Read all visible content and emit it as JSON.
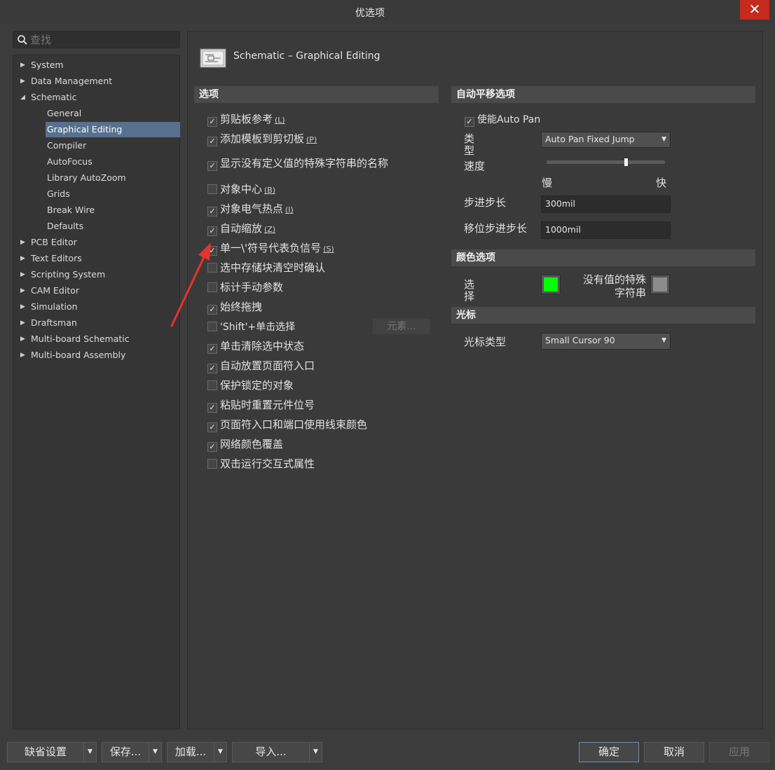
{
  "window": {
    "title": "优选项",
    "close_glyph": "✕"
  },
  "search": {
    "placeholder": "查找",
    "icon": "search-icon"
  },
  "tree": [
    {
      "label": "System",
      "level": 0,
      "expanded": false
    },
    {
      "label": "Data Management",
      "level": 0,
      "expanded": false
    },
    {
      "label": "Schematic",
      "level": 0,
      "expanded": true
    },
    {
      "label": "General",
      "level": 1
    },
    {
      "label": "Graphical Editing",
      "level": 1,
      "selected": true
    },
    {
      "label": "Compiler",
      "level": 1
    },
    {
      "label": "AutoFocus",
      "level": 1
    },
    {
      "label": "Library AutoZoom",
      "level": 1
    },
    {
      "label": "Grids",
      "level": 1
    },
    {
      "label": "Break Wire",
      "level": 1
    },
    {
      "label": "Defaults",
      "level": 1
    },
    {
      "label": "PCB Editor",
      "level": 0,
      "expanded": false
    },
    {
      "label": "Text Editors",
      "level": 0,
      "expanded": false
    },
    {
      "label": "Scripting System",
      "level": 0,
      "expanded": false
    },
    {
      "label": "CAM Editor",
      "level": 0,
      "expanded": false
    },
    {
      "label": "Simulation",
      "level": 0,
      "expanded": false
    },
    {
      "label": "Draftsman",
      "level": 0,
      "expanded": false
    },
    {
      "label": "Multi-board Schematic",
      "level": 0,
      "expanded": false
    },
    {
      "label": "Multi-board Assembly",
      "level": 0,
      "expanded": false
    }
  ],
  "page": {
    "title": "Schematic – Graphical Editing",
    "icon": "schematic-sheet-icon"
  },
  "options": {
    "header": "选项",
    "items": [
      {
        "label": "剪贴板参考",
        "key": "(L)",
        "checked": true
      },
      {
        "label": "添加模板到剪切板",
        "key": "(P)",
        "checked": true
      },
      {
        "label": "显示没有定义值的特殊字符串的名称",
        "key": "",
        "checked": true
      },
      {
        "label": "对象中心",
        "key": "(B)",
        "checked": false
      },
      {
        "label": "对象电气热点",
        "key": "(I)",
        "checked": true
      },
      {
        "label": "自动缩放",
        "key": "(Z)",
        "checked": true
      },
      {
        "label": "单一\\'符号代表负信号",
        "key": "(S)",
        "checked": true
      },
      {
        "label": "选中存储块清空时确认",
        "key": "",
        "checked": false
      },
      {
        "label": "标计手动参数",
        "key": "",
        "checked": false
      },
      {
        "label": "始终拖拽",
        "key": "",
        "checked": true
      },
      {
        "label": "'Shift'+单击选择",
        "key": "",
        "checked": false
      },
      {
        "label": "单击清除选中状态",
        "key": "",
        "checked": true
      },
      {
        "label": "自动放置页面符入口",
        "key": "",
        "checked": true
      },
      {
        "label": "保护锁定的对象",
        "key": "",
        "checked": false
      },
      {
        "label": "粘贴时重置元件位号",
        "key": "",
        "checked": true
      },
      {
        "label": "页面符入口和端口使用线束颜色",
        "key": "",
        "checked": true
      },
      {
        "label": "网络颜色覆盖",
        "key": "",
        "checked": true
      },
      {
        "label": "双击运行交互式属性",
        "key": "",
        "checked": false
      }
    ],
    "elements_button": "元素..."
  },
  "autopan": {
    "header": "自动平移选项",
    "enable_label": "使能Auto Pan",
    "enabled": true,
    "type_label": "类型",
    "type_value": "Auto Pan Fixed Jump",
    "speed_label": "速度",
    "speed_level": 0.67,
    "slow_label": "慢",
    "fast_label": "快",
    "step_label": "步进步长",
    "step_value": "300mil",
    "shift_step_label": "移位步进步长",
    "shift_step_value": "1000mil"
  },
  "color": {
    "header": "颜色选项",
    "select_label": "选择",
    "select_color": "#00ff00",
    "no_value_label_1": "没有值的特殊",
    "no_value_label_2": "字符串",
    "no_value_color": "#8c8c8c"
  },
  "cursor": {
    "header": "光标",
    "type_label": "光标类型",
    "type_value": "Small Cursor 90"
  },
  "footer": {
    "default_button": "缺省设置",
    "save_button": "保存...",
    "load_button": "加载...",
    "import_button": "导入...",
    "ok_button": "确定",
    "cancel_button": "取消",
    "apply_button": "应用"
  },
  "colors": {
    "arrow": "#e8322a",
    "selection": "#58708e"
  }
}
